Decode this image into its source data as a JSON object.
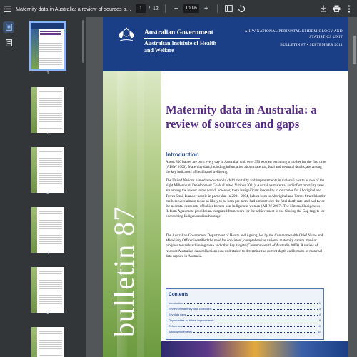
{
  "toolbar": {
    "title": "Maternity data in Australia: a review of sources and gaps ...",
    "current_page": "1",
    "page_separator": "/",
    "total_pages": "12",
    "zoom": "100%",
    "zoom_out": "−",
    "zoom_in": "+"
  },
  "icons": {
    "menu": "menu-icon",
    "fit": "fit-page-icon",
    "rotate": "rotate-icon",
    "download": "download-icon",
    "print": "print-icon",
    "more": "more-vert-icon"
  },
  "thumbnails": [
    {
      "label": "1"
    },
    {
      "label": "2"
    },
    {
      "label": "3"
    },
    {
      "label": "4"
    },
    {
      "label": "5"
    }
  ],
  "document": {
    "gov_name": "Australian Government",
    "agency": "Australian Institute of Health and Welfare",
    "unit": "AIHW NATIONAL PERINATAL EPIDEMIOLOGY AND STATISTICS UNIT",
    "bulletin_id": "BULLETIN 87 • SEPTEMBER 2011",
    "vertical_title": "bulletin 87",
    "title": "Maternity data in Australia: a review of sources and gaps",
    "intro_heading": "Introduction",
    "para1": "About 800 babies are born every day in Australia, with over 350 women becoming a mother for the first time (AIHW 2009). Maternity data, including information about maternal, fetal and neonatal deaths, are among the key indicators of health and wellbeing.",
    "para2": "The United Nations named a reduction in child mortality and improvements in maternal health as two of the eight Millennium Development Goals (United Nations 2001). Australia's maternal and infant mortality rates are among the lowest in the world; however, there is significant inequality in outcomes for Aboriginal and Torres Strait Islander people in particular. In 2001–2004, babies born to Aboriginal and Torres Strait Islander mothers were almost twice as likely to be born pre-term, had almost twice the fetal death rate, and had twice the neonatal death rate of babies born to non-Indigenous women (AIHW 2007). The National Indigenous Reform Agreement provides an integrated framework for the achievement of the Closing the Gap targets for overcoming Indigenous disadvantage.",
    "para3": "The Australian Government Department of Health and Ageing, led by the Commonwealth Chief Nurse and Midwifery Officer identified the need for consistent, comprehensive national maternity data to monitor progress towards achieving these and other key targets (Commonwealth of Australia 2009). A review of relevant Australian data collections was undertaken to determine the current depth and breadth of maternal data capture in Australia.",
    "contents_heading": "Contents",
    "toc": [
      {
        "label": "Introduction",
        "page": "1"
      },
      {
        "label": "Review of maternity data collections",
        "page": "3"
      },
      {
        "label": "Key data gaps",
        "page": "4"
      },
      {
        "label": "Opportunities for future improvements",
        "page": "8"
      },
      {
        "label": "References",
        "page": "10"
      },
      {
        "label": "Acknowledgements",
        "page": "11"
      }
    ]
  },
  "colors": {
    "toolbar": "#323639",
    "viewer_bg": "#525659",
    "header_blue": "#1b3f86",
    "title_purple": "#572a86",
    "accent_green": "#8cb35f",
    "selection": "#8ab4f8"
  }
}
